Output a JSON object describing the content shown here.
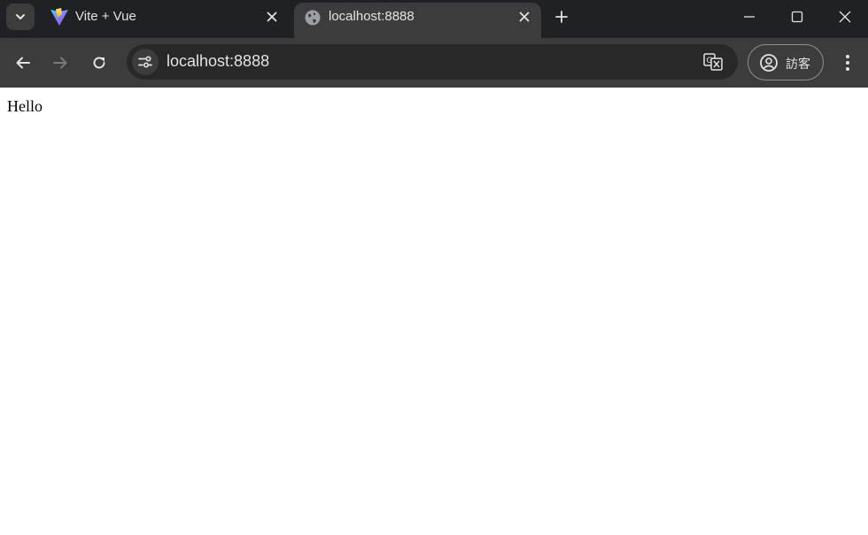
{
  "browser": {
    "tabs": [
      {
        "title": "Vite + Vue",
        "favicon": "vite-logo-icon",
        "active": false
      },
      {
        "title": "localhost:8888",
        "favicon": "globe-icon",
        "active": true
      }
    ],
    "new_tab_icon": "plus-icon",
    "window_controls": [
      "minimize-icon",
      "maximize-icon",
      "close-icon"
    ]
  },
  "toolbar": {
    "back_icon": "arrow-left-icon",
    "forward_icon": "arrow-right-icon",
    "reload_icon": "reload-icon",
    "site_info_icon": "tune-icon",
    "url": "localhost:8888",
    "translate_icon": "translate-icon",
    "profile": {
      "label": "訪客",
      "icon": "account-circle-icon"
    },
    "menu_icon": "more-vert-icon"
  },
  "page": {
    "body_text": "Hello"
  },
  "colors": {
    "tabstrip_bg": "#202124",
    "toolbar_bg": "#3c3c3c",
    "omnibox_bg": "#282828",
    "page_bg": "#ffffff",
    "chrome_text": "#e3e3e3"
  }
}
